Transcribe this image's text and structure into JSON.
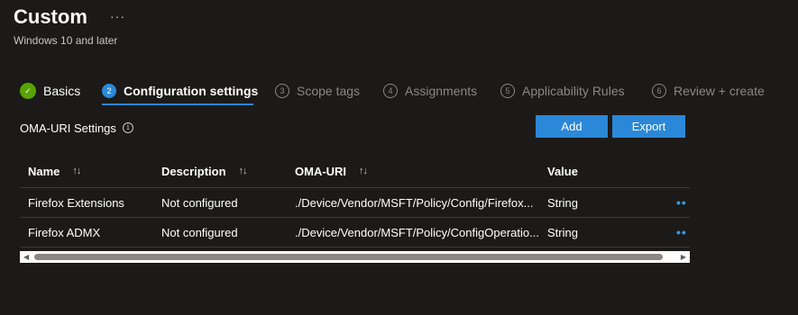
{
  "header": {
    "title": "Custom",
    "more": "···",
    "subtitle": "Windows 10 and later"
  },
  "steps": [
    {
      "num": "✓",
      "label": "Basics",
      "state": "done"
    },
    {
      "num": "2",
      "label": "Configuration settings",
      "state": "active"
    },
    {
      "num": "3",
      "label": "Scope tags",
      "state": "disabled"
    },
    {
      "num": "4",
      "label": "Assignments",
      "state": "disabled"
    },
    {
      "num": "5",
      "label": "Applicability Rules",
      "state": "disabled"
    },
    {
      "num": "6",
      "label": "Review + create",
      "state": "disabled"
    }
  ],
  "settings": {
    "label": "OMA-URI Settings",
    "info_icon": "i",
    "add_label": "Add",
    "export_label": "Export"
  },
  "table": {
    "columns": [
      "Name",
      "Description",
      "OMA-URI",
      "Value"
    ],
    "sort_icon": "↑↓",
    "rows": [
      {
        "name": "Firefox Extensions",
        "description": "Not configured",
        "oma_uri": "./Device/Vendor/MSFT/Policy/Config/Firefox...",
        "value": "String",
        "actions": "••"
      },
      {
        "name": "Firefox ADMX",
        "description": "Not configured",
        "oma_uri": "./Device/Vendor/MSFT/Policy/ConfigOperatio...",
        "value": "String",
        "actions": "••"
      }
    ]
  },
  "scrollbar": {
    "left_arrow": "◀",
    "right_arrow": "▶"
  },
  "colors": {
    "background": "#1b1a19",
    "accent": "#2b88d8",
    "success": "#57a300",
    "muted": "#8a8886"
  }
}
